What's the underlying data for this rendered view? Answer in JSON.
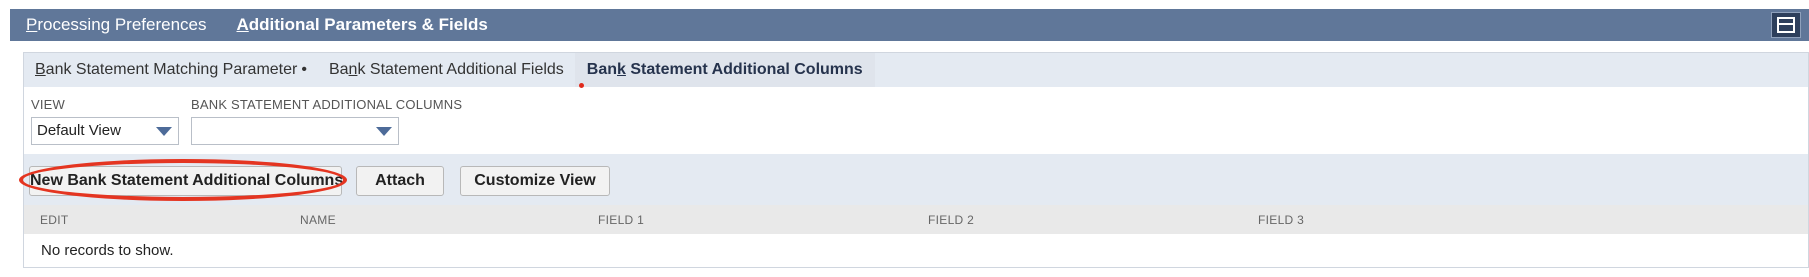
{
  "top_tabs": [
    {
      "label_first": "P",
      "label_rest": "rocessing Preferences"
    },
    {
      "label_first": "A",
      "label_rest": "dditional Parameters & Fields"
    }
  ],
  "layout_toggle_icon": "layout-toggle-icon",
  "sub_tabs": [
    {
      "pre": "",
      "u": "B",
      "post": "ank Statement Matching Parameter",
      "dot": "•"
    },
    {
      "pre": "Ba",
      "u": "n",
      "post": "k Statement Additional Fields"
    },
    {
      "pre": "Ban",
      "u": "k",
      "post": " Statement Additional Columns"
    }
  ],
  "filters": {
    "view_label": "VIEW",
    "view_value": "Default View",
    "columns_label": "BANK STATEMENT ADDITIONAL COLUMNS",
    "columns_value": ""
  },
  "buttons": {
    "new": "New Bank Statement Additional Columns",
    "attach": "Attach",
    "customize": "Customize View"
  },
  "table": {
    "headers": [
      "EDIT",
      "NAME",
      "FIELD 1",
      "FIELD 2",
      "FIELD 3"
    ],
    "empty_message": "No records to show."
  },
  "colors": {
    "header_bar": "#607799",
    "panel_bg": "#e4eaf2",
    "annotation_red": "#e43521"
  }
}
